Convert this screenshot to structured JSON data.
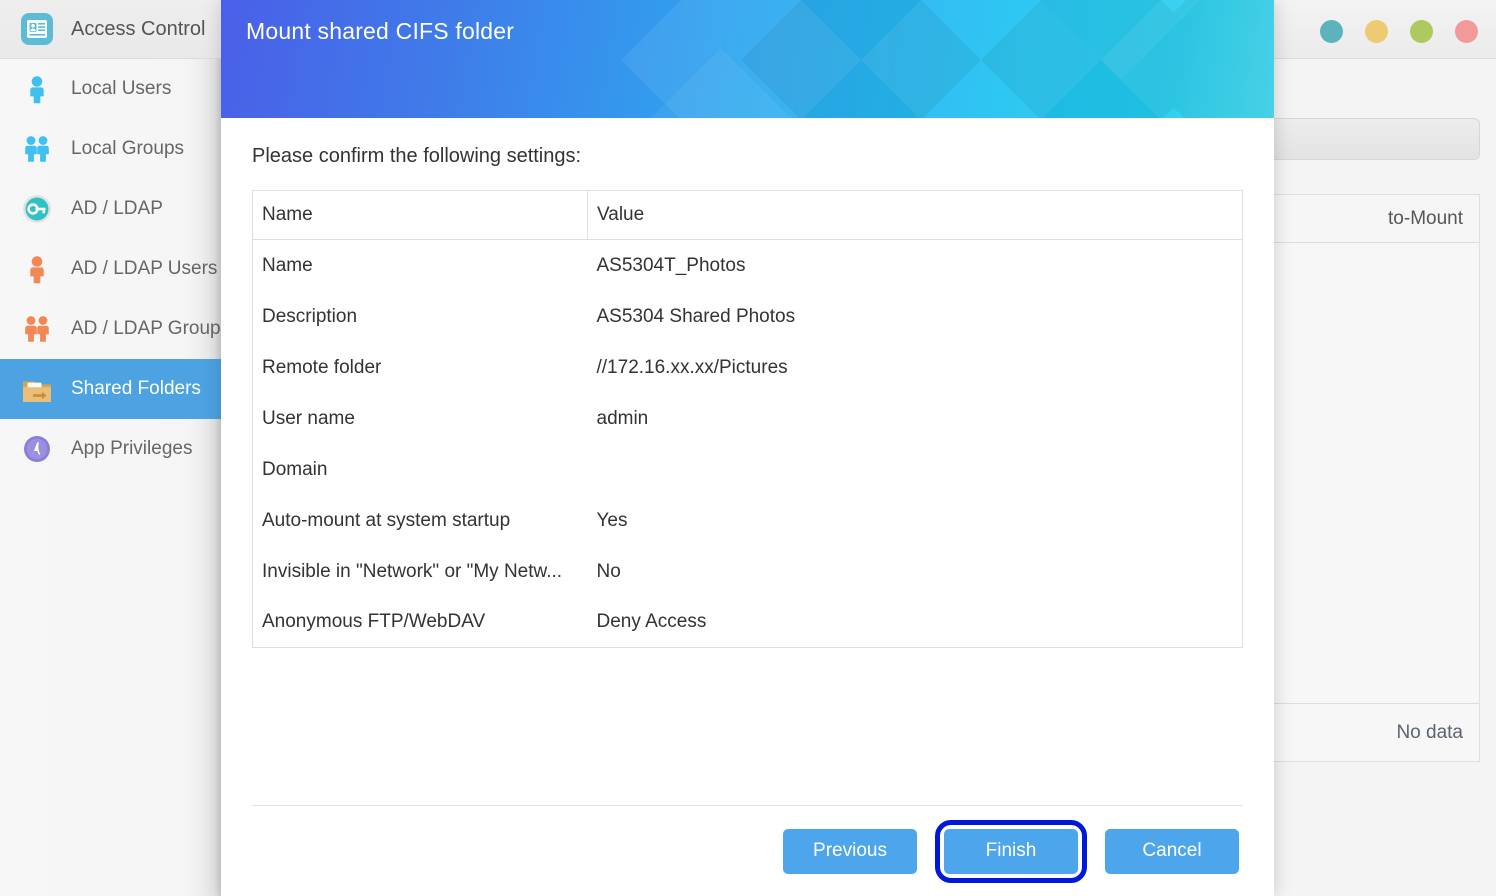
{
  "sidebar": {
    "header": {
      "label": "Access Control",
      "icon": "id-card-icon"
    },
    "items": [
      {
        "label": "Local Users",
        "icon": "user-blue-icon",
        "selected": false
      },
      {
        "label": "Local Groups",
        "icon": "users-blue-icon",
        "selected": false
      },
      {
        "label": "AD / LDAP",
        "icon": "key-icon",
        "selected": false
      },
      {
        "label": "AD / LDAP Users",
        "icon": "user-orange-icon",
        "selected": false
      },
      {
        "label": "AD / LDAP Groups",
        "icon": "users-orange-icon",
        "selected": false
      },
      {
        "label": "Shared Folders",
        "icon": "folder-mount-icon",
        "selected": true
      },
      {
        "label": "App Privileges",
        "icon": "app-a-icon",
        "selected": false
      }
    ]
  },
  "background_window": {
    "status_dots": [
      {
        "name": "dot-teal",
        "color": "#5cb3bc"
      },
      {
        "name": "dot-yellow",
        "color": "#eecb73"
      },
      {
        "name": "dot-green",
        "color": "#aec95e"
      },
      {
        "name": "dot-pink",
        "color": "#f09a9a"
      }
    ],
    "table": {
      "visible_column_header": "to-Mount",
      "empty_text": "No data"
    }
  },
  "dialog": {
    "title": "Mount shared CIFS folder",
    "instruction": "Please confirm the following settings:",
    "table": {
      "headers": {
        "name": "Name",
        "value": "Value"
      },
      "rows": [
        {
          "name": "Name",
          "value": "AS5304T_Photos"
        },
        {
          "name": "Description",
          "value": "AS5304 Shared Photos"
        },
        {
          "name": "Remote folder",
          "value": "//172.16.xx.xx/Pictures"
        },
        {
          "name": "User name",
          "value": "admin"
        },
        {
          "name": "Domain",
          "value": ""
        },
        {
          "name": "Auto-mount at system startup",
          "value": "Yes"
        },
        {
          "name": "Invisible in \"Network\" or \"My Netw...",
          "value": "No"
        },
        {
          "name": "Anonymous FTP/WebDAV",
          "value": "Deny Access"
        }
      ]
    },
    "buttons": {
      "previous": "Previous",
      "finish": "Finish",
      "cancel": "Cancel"
    },
    "accent_color": "#4da6ec",
    "highlight_color": "#0018d9"
  }
}
